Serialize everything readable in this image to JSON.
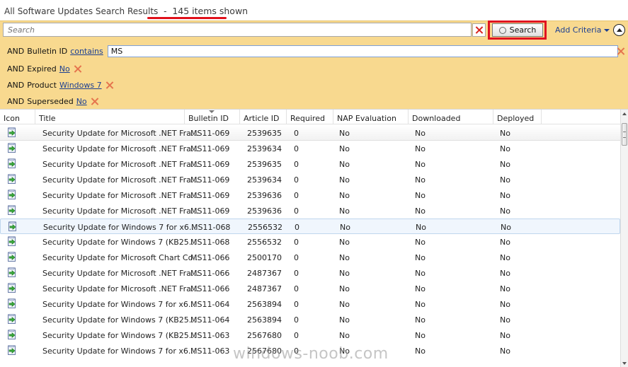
{
  "title": {
    "text": "All Software Updates Search Results",
    "separator": "-",
    "count": "145 items shown"
  },
  "search": {
    "placeholder": "Search",
    "button_label": "Search",
    "add_criteria_label": "Add Criteria"
  },
  "criteria": [
    {
      "and": "AND",
      "label": "Bulletin ID",
      "operator": "contains",
      "value": "MS"
    },
    {
      "and": "AND",
      "label": "Expired",
      "value": "No"
    },
    {
      "and": "AND",
      "label": "Product",
      "value": "Windows 7"
    },
    {
      "and": "AND",
      "label": "Superseded",
      "value": "No"
    }
  ],
  "columns": [
    "Icon",
    "Title",
    "Bulletin ID",
    "Article ID",
    "Required",
    "NAP Evaluation",
    "Downloaded",
    "Deployed"
  ],
  "rows": [
    {
      "title": "Security Update for Microsoft .NET Fra...",
      "bulletin": "MS11-069",
      "article": "2539635",
      "required": "0",
      "nap": "No",
      "downloaded": "No",
      "deployed": "No"
    },
    {
      "title": "Security Update for Microsoft .NET Fra...",
      "bulletin": "MS11-069",
      "article": "2539634",
      "required": "0",
      "nap": "No",
      "downloaded": "No",
      "deployed": "No"
    },
    {
      "title": "Security Update for Microsoft .NET Fra...",
      "bulletin": "MS11-069",
      "article": "2539635",
      "required": "0",
      "nap": "No",
      "downloaded": "No",
      "deployed": "No"
    },
    {
      "title": "Security Update for Microsoft .NET Fra...",
      "bulletin": "MS11-069",
      "article": "2539634",
      "required": "0",
      "nap": "No",
      "downloaded": "No",
      "deployed": "No"
    },
    {
      "title": "Security Update for Microsoft .NET Fra...",
      "bulletin": "MS11-069",
      "article": "2539636",
      "required": "0",
      "nap": "No",
      "downloaded": "No",
      "deployed": "No"
    },
    {
      "title": "Security Update for Microsoft .NET Fra...",
      "bulletin": "MS11-069",
      "article": "2539636",
      "required": "0",
      "nap": "No",
      "downloaded": "No",
      "deployed": "No"
    },
    {
      "title": "Security Update for Windows 7 for x6...",
      "bulletin": "MS11-068",
      "article": "2556532",
      "required": "0",
      "nap": "No",
      "downloaded": "No",
      "deployed": "No"
    },
    {
      "title": "Security Update for Windows 7 (KB25...",
      "bulletin": "MS11-068",
      "article": "2556532",
      "required": "0",
      "nap": "No",
      "downloaded": "No",
      "deployed": "No"
    },
    {
      "title": "Security Update for Microsoft Chart Co...",
      "bulletin": "MS11-066",
      "article": "2500170",
      "required": "0",
      "nap": "No",
      "downloaded": "No",
      "deployed": "No"
    },
    {
      "title": "Security Update for Microsoft .NET Fra...",
      "bulletin": "MS11-066",
      "article": "2487367",
      "required": "0",
      "nap": "No",
      "downloaded": "No",
      "deployed": "No"
    },
    {
      "title": "Security Update for Microsoft .NET Fra...",
      "bulletin": "MS11-066",
      "article": "2487367",
      "required": "0",
      "nap": "No",
      "downloaded": "No",
      "deployed": "No"
    },
    {
      "title": "Security Update for Windows 7 for x6...",
      "bulletin": "MS11-064",
      "article": "2563894",
      "required": "0",
      "nap": "No",
      "downloaded": "No",
      "deployed": "No"
    },
    {
      "title": "Security Update for Windows 7 (KB25...",
      "bulletin": "MS11-064",
      "article": "2563894",
      "required": "0",
      "nap": "No",
      "downloaded": "No",
      "deployed": "No"
    },
    {
      "title": "Security Update for Windows 7 (KB25...",
      "bulletin": "MS11-063",
      "article": "2567680",
      "required": "0",
      "nap": "No",
      "downloaded": "No",
      "deployed": "No"
    },
    {
      "title": "Security Update for Windows 7 for x6...",
      "bulletin": "MS11-063",
      "article": "2567680",
      "required": "0",
      "nap": "No",
      "downloaded": "No",
      "deployed": "No"
    }
  ],
  "watermark": "windows-noob.com",
  "colors": {
    "criteria_bg": "#f8d98f",
    "highlight": "#e01020",
    "link": "#1c3f92"
  }
}
